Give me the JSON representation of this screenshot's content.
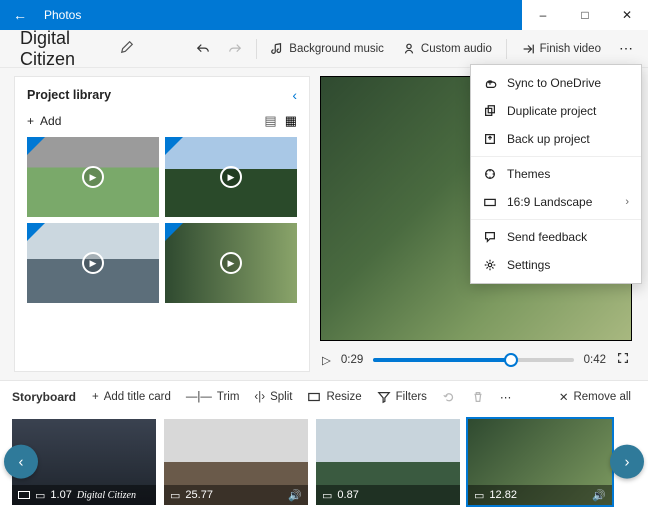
{
  "window": {
    "title": "Photos"
  },
  "project": {
    "name": "Digital Citizen"
  },
  "toolbar": {
    "bg_music": "Background music",
    "custom_audio": "Custom audio",
    "finish": "Finish video"
  },
  "library": {
    "title": "Project library",
    "add": "Add"
  },
  "preview": {
    "current": "0:29",
    "total": "0:42",
    "progress_pct": 69
  },
  "menu": {
    "sync": "Sync to OneDrive",
    "duplicate": "Duplicate project",
    "backup": "Back up project",
    "themes": "Themes",
    "aspect": "16:9 Landscape",
    "feedback": "Send feedback",
    "settings": "Settings"
  },
  "storyboard": {
    "title": "Storyboard",
    "add_title": "Add title card",
    "trim": "Trim",
    "split": "Split",
    "resize": "Resize",
    "filters": "Filters",
    "remove_all": "Remove all"
  },
  "clips": [
    {
      "duration": "1.07",
      "caption": "Digital Citizen",
      "audio": false,
      "aspect_icon": true
    },
    {
      "duration": "25.77",
      "caption": "",
      "audio": true,
      "aspect_icon": false
    },
    {
      "duration": "0.87",
      "caption": "",
      "audio": false,
      "aspect_icon": false
    },
    {
      "duration": "12.82",
      "caption": "",
      "audio": true,
      "aspect_icon": false
    }
  ]
}
